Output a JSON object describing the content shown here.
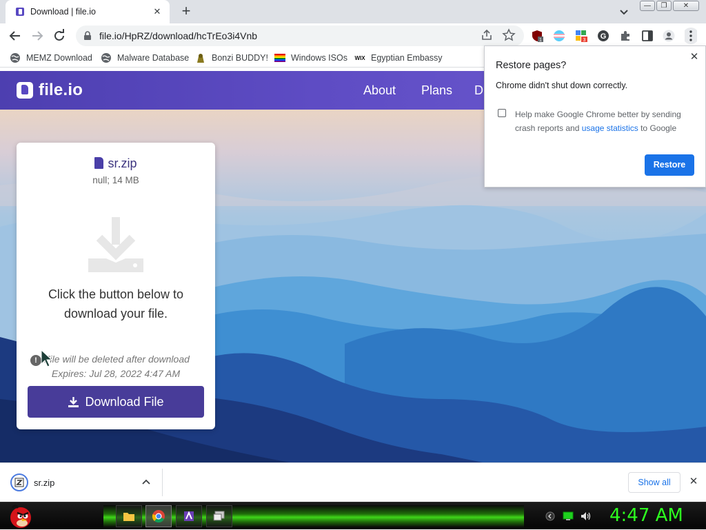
{
  "browser": {
    "tab": {
      "title": "Download | file.io",
      "close": "✕"
    },
    "new_tab": "+",
    "window_controls": [
      "—",
      "❐",
      "✕"
    ],
    "url": "file.io/HpRZ/download/hcTrEo3i4Vnb",
    "extension_badges": {
      "shield": "1",
      "grid": "3"
    },
    "bookmarks": [
      {
        "label": "MEMZ Download",
        "icon": "globe-icon"
      },
      {
        "label": "Malware Database",
        "icon": "globe-icon"
      },
      {
        "label": "Bonzi BUDDY!",
        "icon": "bonzi-icon"
      },
      {
        "label": "Windows ISOs",
        "icon": "rainbow-flag-icon"
      },
      {
        "label": "Egyptian Embassy",
        "icon": "wix-icon"
      }
    ]
  },
  "site": {
    "logo": "file.io",
    "nav": [
      "About",
      "Plans",
      "D"
    ],
    "card": {
      "filename": "sr.zip",
      "meta": "null; 14 MB",
      "instruction": "Click the button below to download your file.",
      "warning": "File will be deleted after download",
      "expires": "Expires: Jul 28, 2022 4:47 AM",
      "button": "Download File"
    }
  },
  "restore_bubble": {
    "title": "Restore pages?",
    "message": "Chrome didn't shut down correctly.",
    "checkbox_text_1": "Help make Google Chrome better by sending crash reports and ",
    "checkbox_link": "usage statistics",
    "checkbox_text_2": " to Google",
    "button": "Restore",
    "close": "✕"
  },
  "download_bar": {
    "item": "sr.zip",
    "show_all": "Show all",
    "close": "✕"
  },
  "taskbar": {
    "clock": "4:47 AM"
  },
  "colors": {
    "brand": "#5848c2",
    "chrome_blue": "#1a73e8",
    "clock_green": "#2dff1f"
  }
}
